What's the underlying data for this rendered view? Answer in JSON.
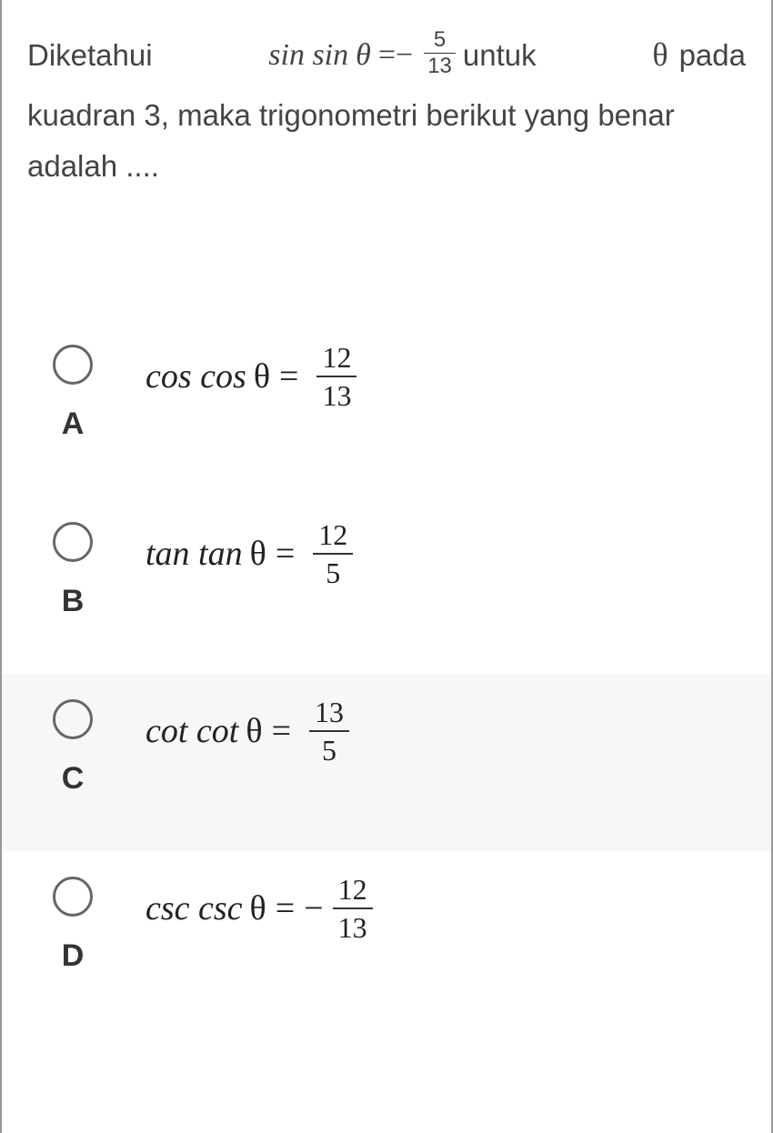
{
  "question": {
    "part1": "Diketahui",
    "func_sin": "sin sin",
    "theta": "θ",
    "eq_minus": "=−",
    "frac_num": "5",
    "frac_den": "13",
    "part2": "untuk",
    "theta2": "θ",
    "part3": "pada",
    "line2": "kuadran 3, maka trigonometri berikut yang benar adalah ...."
  },
  "options": [
    {
      "label": "A",
      "func": "cos cos",
      "theta": "θ",
      "sign": "=",
      "neg": "",
      "num": "12",
      "den": "13"
    },
    {
      "label": "B",
      "func": "tan tan",
      "theta": "θ",
      "sign": "=",
      "neg": "",
      "num": "12",
      "den": "5"
    },
    {
      "label": "C",
      "func": "cot cot",
      "theta": "θ",
      "sign": "=",
      "neg": "",
      "num": "13",
      "den": "5"
    },
    {
      "label": "D",
      "func": "csc csc",
      "theta": "θ",
      "sign": "=",
      "neg": "−",
      "num": "12",
      "den": "13"
    }
  ]
}
